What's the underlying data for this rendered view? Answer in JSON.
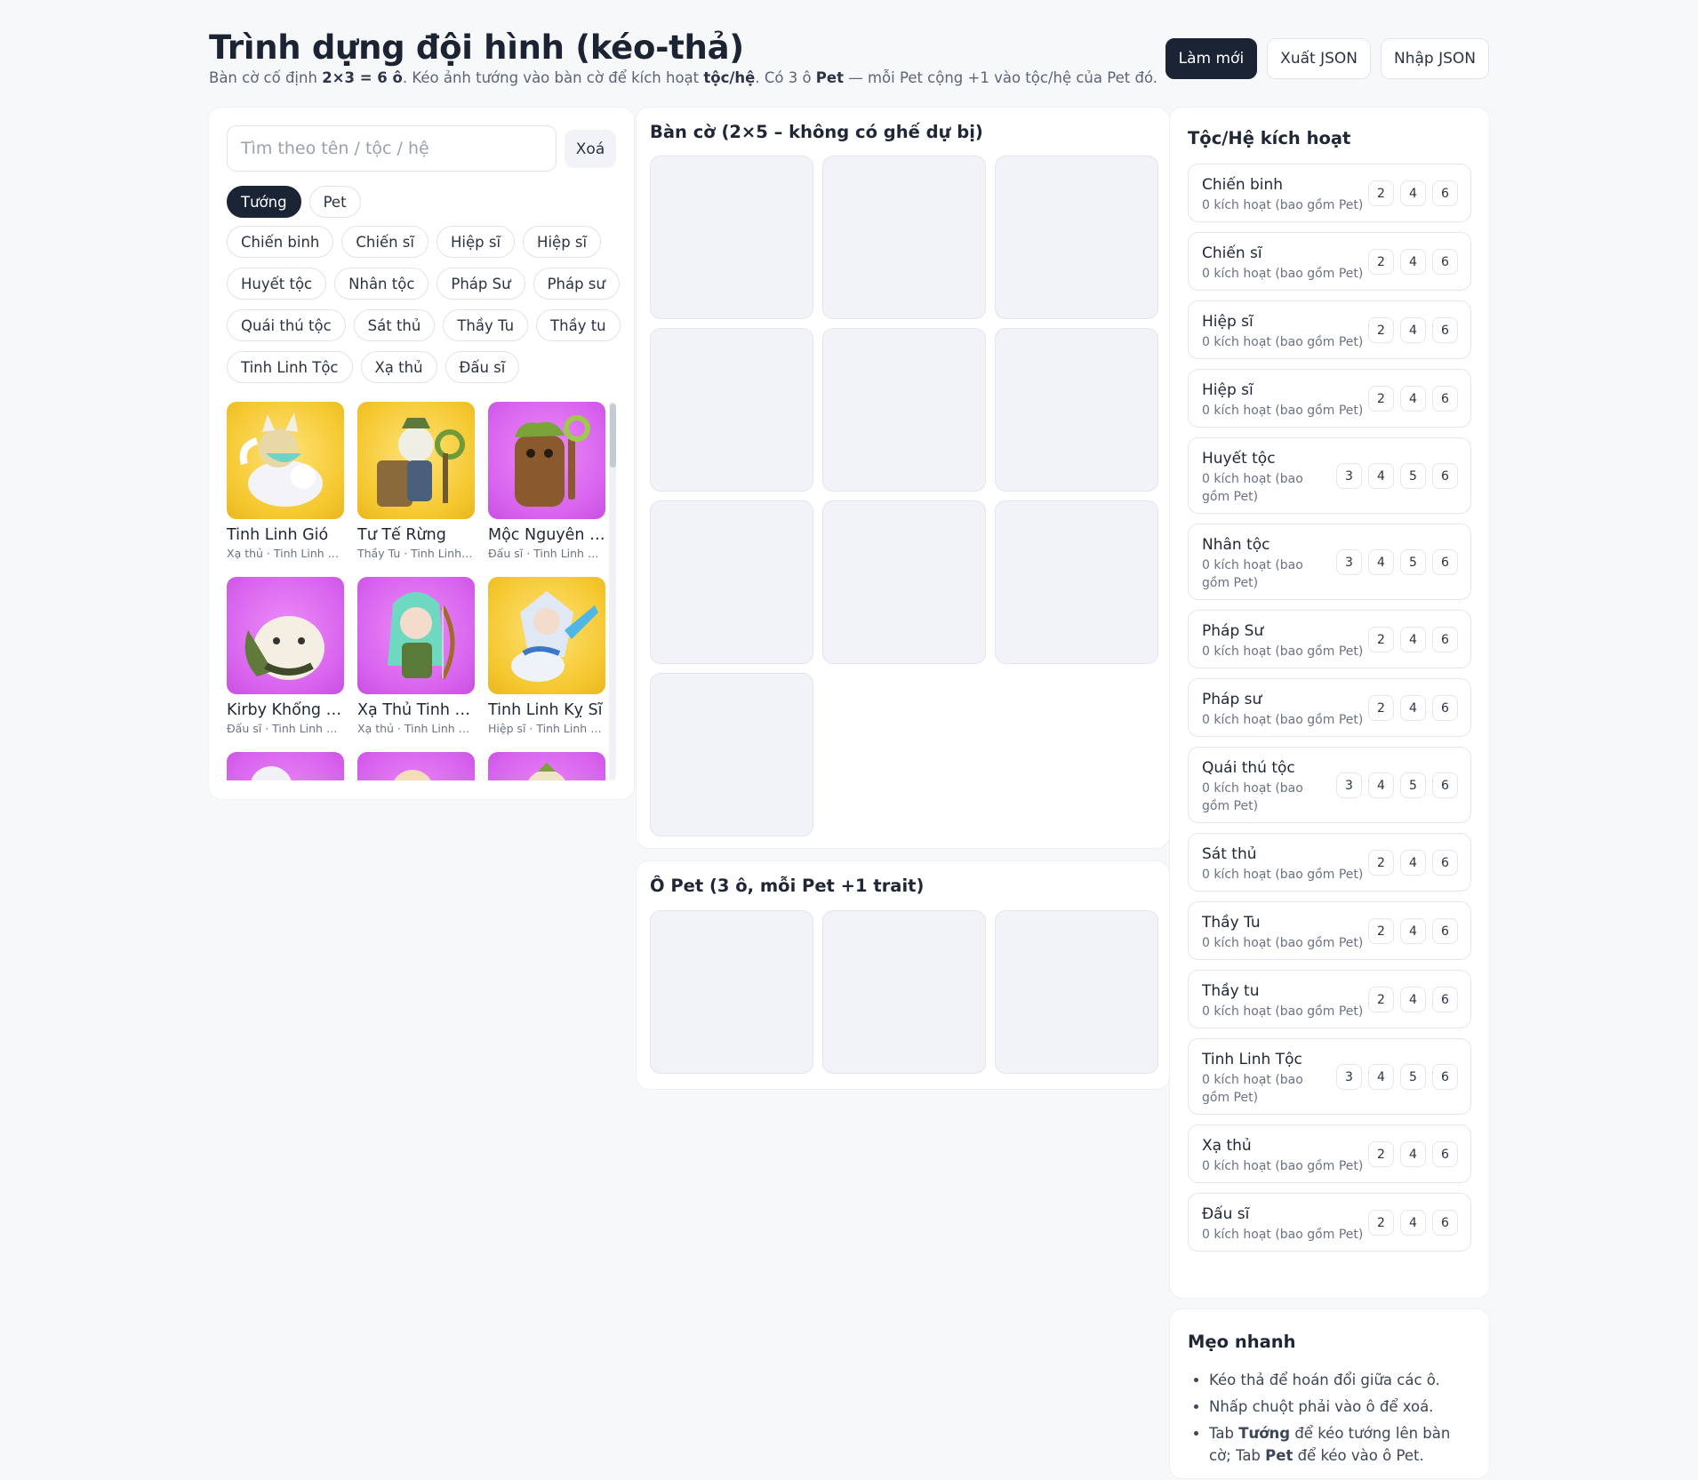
{
  "header": {
    "title": "Trình dựng đội hình (kéo-thả)",
    "subtitle_1": "Bàn cờ cố định ",
    "subtitle_b1": "2×3 = 6 ô",
    "subtitle_2": ". Kéo ảnh tướng vào bàn cờ để kích hoạt ",
    "subtitle_b2": "tộc/hệ",
    "subtitle_3": ". Có 3 ô ",
    "subtitle_b3": "Pet",
    "subtitle_4": " — mỗi Pet cộng +1 vào tộc/hệ của Pet đó.",
    "actions": {
      "reset": "Làm mới",
      "export": "Xuất JSON",
      "import": "Nhập JSON"
    }
  },
  "search": {
    "placeholder": "Tìm theo tên / tộc / hệ",
    "value": "",
    "clear": "Xoá"
  },
  "tabs": [
    {
      "label": "Tướng"
    },
    {
      "label": "Pet"
    }
  ],
  "filters": [
    "Chiến binh",
    "Chiến sĩ",
    "Hiệp sĩ",
    "Hiệp sĩ",
    "Huyết tộc",
    "Nhân tộc",
    "Pháp Sư",
    "Pháp sư",
    "Quái thú tộc",
    "Sát thủ",
    "Thầy Tu",
    "Thầy tu",
    "Tinh Linh Tộc",
    "Xạ thủ",
    "Đấu sĩ"
  ],
  "units": [
    {
      "name": "Tinh Linh Gió",
      "traits": "Xạ thủ · Tinh Linh Tộc",
      "bg": "yellow",
      "icon": "wind-spirit-fox-icon"
    },
    {
      "name": "Tư Tế Rừng",
      "traits": "Thầy Tu · Tinh Linh Tộc",
      "bg": "yellow",
      "icon": "forest-priest-icon"
    },
    {
      "name": "Mộc Nguyên Sứ",
      "traits": "Đấu sĩ · Tinh Linh Tộc",
      "bg": "purple",
      "icon": "treant-icon"
    },
    {
      "name": "Kirby Khổng Lồ",
      "traits": "Đấu sĩ · Tinh Linh Tộc",
      "bg": "purple",
      "icon": "giant-bear-icon"
    },
    {
      "name": "Xạ Thủ Tinh Linh",
      "traits": "Xạ thủ · Tinh Linh Tộc",
      "bg": "purple",
      "icon": "elf-archer-icon"
    },
    {
      "name": "Tinh Linh Kỵ Sĩ",
      "traits": "Hiệp sĩ · Tinh Linh Tộc",
      "bg": "yellow",
      "icon": "elf-knight-icon"
    },
    {
      "name": "",
      "traits": "",
      "bg": "purple",
      "icon": "unit-icon"
    },
    {
      "name": "",
      "traits": "",
      "bg": "purple",
      "icon": "unit-icon"
    },
    {
      "name": "",
      "traits": "",
      "bg": "purple",
      "icon": "unit-icon"
    }
  ],
  "board": {
    "title": "Bàn cờ (2×5 – không có ghế dự bị)",
    "cells": 10
  },
  "pets": {
    "title": "Ô Pet (3 ô, mỗi Pet +1 trait)",
    "cells": 3
  },
  "traits_panel": {
    "title": "Tộc/Hệ kích hoạt",
    "items": [
      {
        "name": "Chiến binh",
        "sub": "0 kích hoạt (bao gồm Pet)",
        "steps": [
          "2",
          "4",
          "6"
        ]
      },
      {
        "name": "Chiến sĩ",
        "sub": "0 kích hoạt (bao gồm Pet)",
        "steps": [
          "2",
          "4",
          "6"
        ]
      },
      {
        "name": "Hiệp sĩ",
        "sub": "0 kích hoạt (bao gồm Pet)",
        "steps": [
          "2",
          "4",
          "6"
        ]
      },
      {
        "name": "Hiệp sĩ",
        "sub": "0 kích hoạt (bao gồm Pet)",
        "steps": [
          "2",
          "4",
          "6"
        ]
      },
      {
        "name": "Huyết tộc",
        "sub": "0 kích hoạt (bao gồm Pet)",
        "steps": [
          "3",
          "4",
          "5",
          "6"
        ]
      },
      {
        "name": "Nhân tộc",
        "sub": "0 kích hoạt (bao gồm Pet)",
        "steps": [
          "3",
          "4",
          "5",
          "6"
        ]
      },
      {
        "name": "Pháp Sư",
        "sub": "0 kích hoạt (bao gồm Pet)",
        "steps": [
          "2",
          "4",
          "6"
        ]
      },
      {
        "name": "Pháp sư",
        "sub": "0 kích hoạt (bao gồm Pet)",
        "steps": [
          "2",
          "4",
          "6"
        ]
      },
      {
        "name": "Quái thú tộc",
        "sub": "0 kích hoạt (bao gồm Pet)",
        "steps": [
          "3",
          "4",
          "5",
          "6"
        ]
      },
      {
        "name": "Sát thủ",
        "sub": "0 kích hoạt (bao gồm Pet)",
        "steps": [
          "2",
          "4",
          "6"
        ]
      },
      {
        "name": "Thầy Tu",
        "sub": "0 kích hoạt (bao gồm Pet)",
        "steps": [
          "2",
          "4",
          "6"
        ]
      },
      {
        "name": "Thầy tu",
        "sub": "0 kích hoạt (bao gồm Pet)",
        "steps": [
          "2",
          "4",
          "6"
        ]
      },
      {
        "name": "Tinh Linh Tộc",
        "sub": "0 kích hoạt (bao gồm Pet)",
        "steps": [
          "3",
          "4",
          "5",
          "6"
        ]
      },
      {
        "name": "Xạ thủ",
        "sub": "0 kích hoạt (bao gồm Pet)",
        "steps": [
          "2",
          "4",
          "6"
        ]
      },
      {
        "name": "Đấu sĩ",
        "sub": "0 kích hoạt (bao gồm Pet)",
        "steps": [
          "2",
          "4",
          "6"
        ]
      }
    ]
  },
  "tips": {
    "title": "Mẹo nhanh",
    "t1": "Kéo thả để hoán đổi giữa các ô.",
    "t2": "Nhấp chuột phải vào ô để xoá.",
    "t3a": "Tab ",
    "t3b": "Tướng",
    "t3c": " để kéo tướng lên bàn cờ; Tab ",
    "t3d": "Pet",
    "t3e": " để kéo vào ô Pet."
  }
}
